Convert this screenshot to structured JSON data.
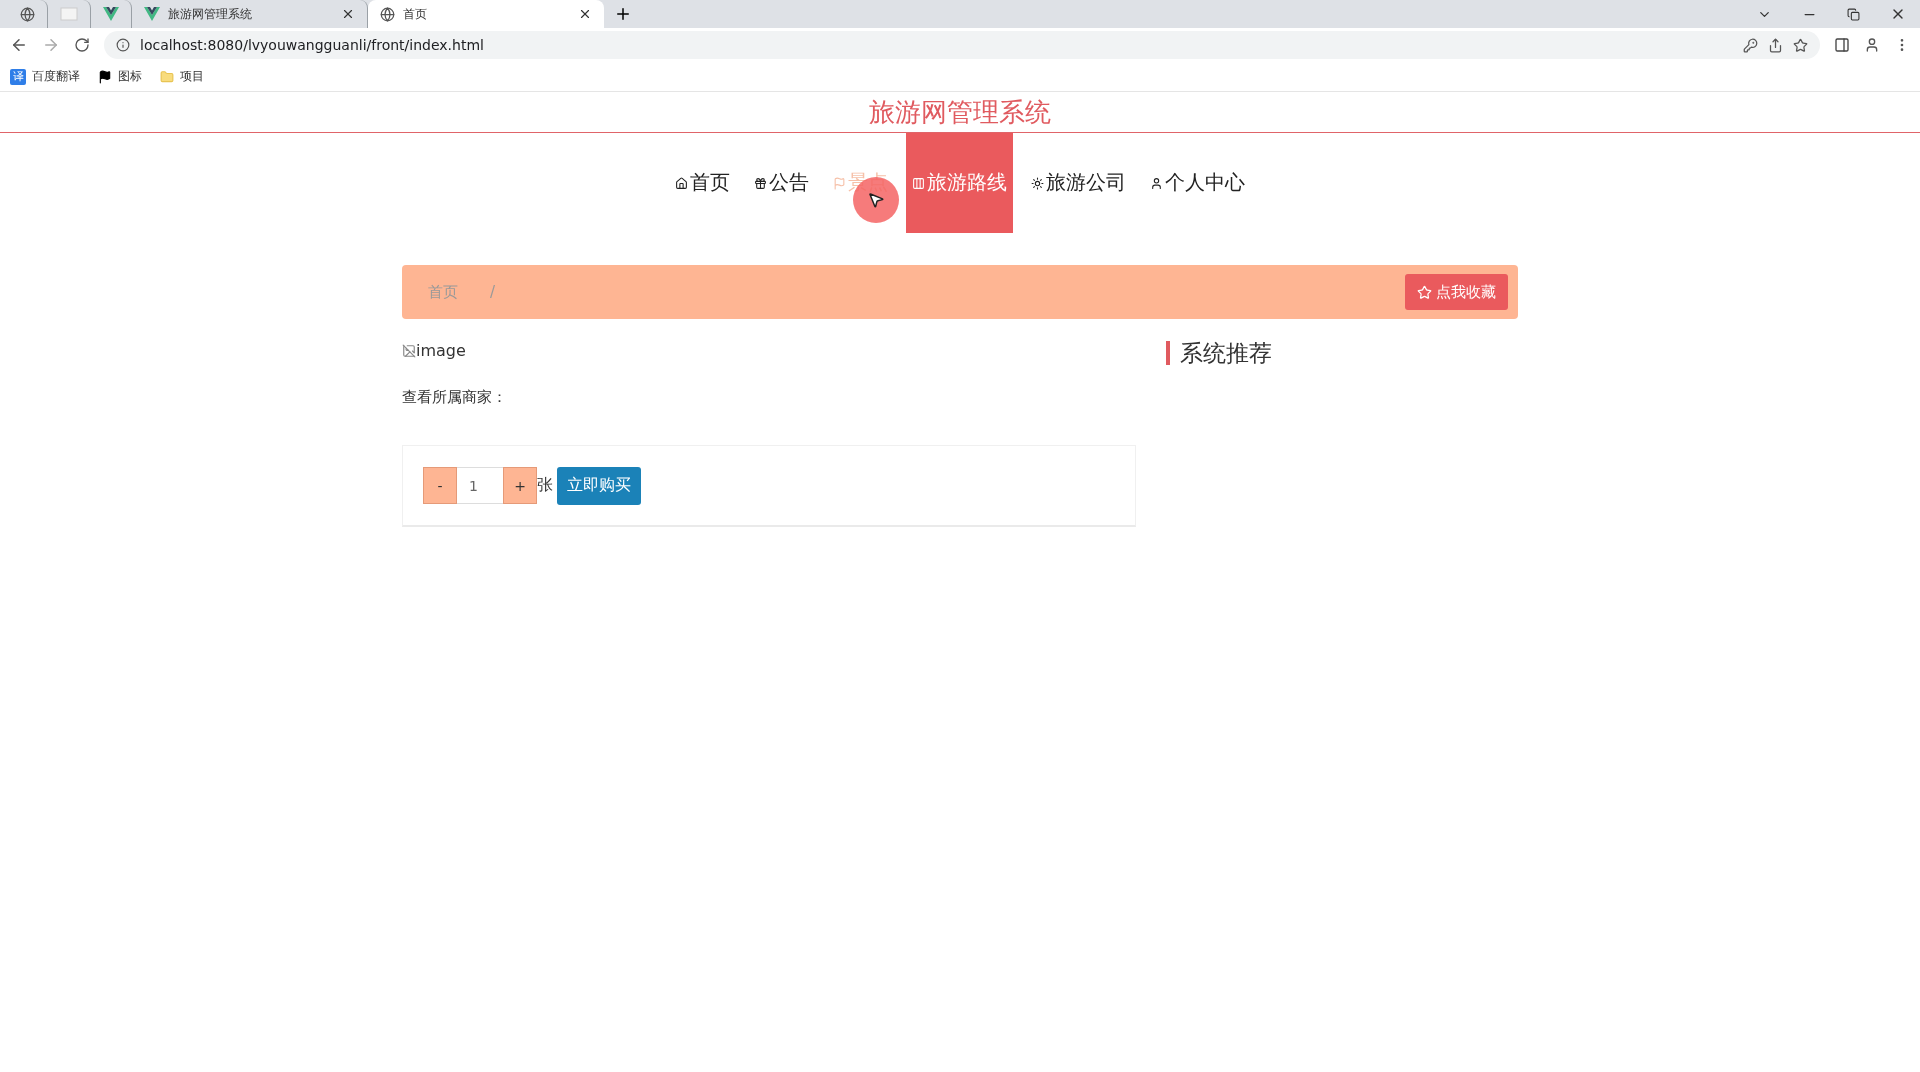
{
  "browser": {
    "tabs": [
      {
        "kind": "globe",
        "selected": false
      },
      {
        "kind": "page",
        "selected": false
      },
      {
        "kind": "vue",
        "selected": false
      },
      {
        "kind": "vue",
        "title": "旅游网管理系统",
        "selected": false
      },
      {
        "kind": "globe",
        "title": "首页",
        "selected": true
      }
    ],
    "url": "localhost:8080/lvyouwangguanli/front/index.html",
    "bookmarks": [
      {
        "kind": "badge",
        "badge": "译",
        "label": "百度翻译"
      },
      {
        "kind": "flag",
        "label": "图标"
      },
      {
        "kind": "folder",
        "label": "项目"
      }
    ]
  },
  "header": {
    "title": "旅游网管理系统"
  },
  "nav": [
    {
      "label": "首页",
      "selected": false,
      "hovered": false
    },
    {
      "label": "公告",
      "selected": false,
      "hovered": false
    },
    {
      "label": "景点",
      "selected": false,
      "hovered": true
    },
    {
      "label": "旅游路线",
      "selected": true,
      "hovered": false
    },
    {
      "label": "旅游公司",
      "selected": false,
      "hovered": false
    },
    {
      "label": "个人中心",
      "selected": false,
      "hovered": false
    }
  ],
  "breadcrumb": {
    "items": [
      "首页"
    ],
    "separator": "/",
    "favorite_button": "点我收藏"
  },
  "detail": {
    "image_alt": "image",
    "merchant_label": "查看所属商家：",
    "quantity": {
      "minus": "-",
      "value": "1",
      "plus": "+",
      "unit": "张"
    },
    "buy_button": "立即购买"
  },
  "sidebar": {
    "title": "系统推荐"
  }
}
